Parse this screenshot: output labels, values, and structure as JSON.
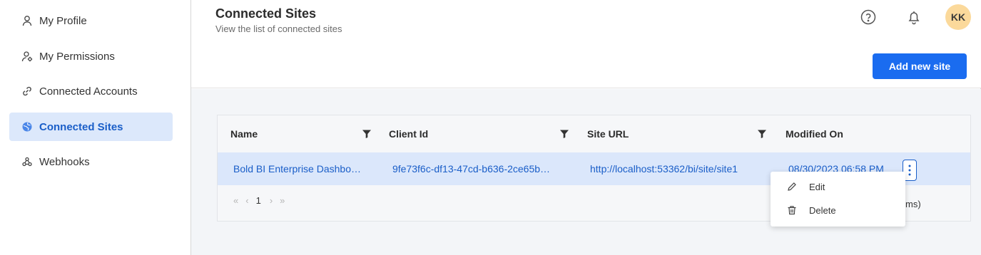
{
  "sidebar": {
    "items": [
      {
        "label": "My Profile",
        "icon": "user-icon"
      },
      {
        "label": "My Permissions",
        "icon": "user-gear-icon"
      },
      {
        "label": "Connected Accounts",
        "icon": "link-icon"
      },
      {
        "label": "Connected Sites",
        "icon": "globe-icon",
        "active": true
      },
      {
        "label": "Webhooks",
        "icon": "webhook-icon"
      }
    ]
  },
  "header": {
    "title": "Connected Sites",
    "subtitle": "View the list of connected sites",
    "avatar_initials": "KK",
    "add_button_label": "Add new site"
  },
  "grid": {
    "columns": [
      "Name",
      "Client Id",
      "Site URL",
      "Modified On"
    ],
    "rows": [
      {
        "name": "Bold BI Enterprise Dashbo…",
        "client_id": "9fe73f6c-df13-47cd-b636-2ce65b…",
        "site_url": "http://localhost:53362/bi/site/site1",
        "modified_on": "08/30/2023 06:58 PM"
      }
    ],
    "pager": {
      "current_page": "1",
      "items_tail": "ms)"
    }
  },
  "context_menu": {
    "items": [
      {
        "label": "Edit",
        "icon": "pencil-icon"
      },
      {
        "label": "Delete",
        "icon": "trash-icon"
      }
    ]
  },
  "colors": {
    "accent": "#1a6cf0",
    "active_bg": "#dce8fb",
    "avatar_bg": "#fbd99b"
  }
}
